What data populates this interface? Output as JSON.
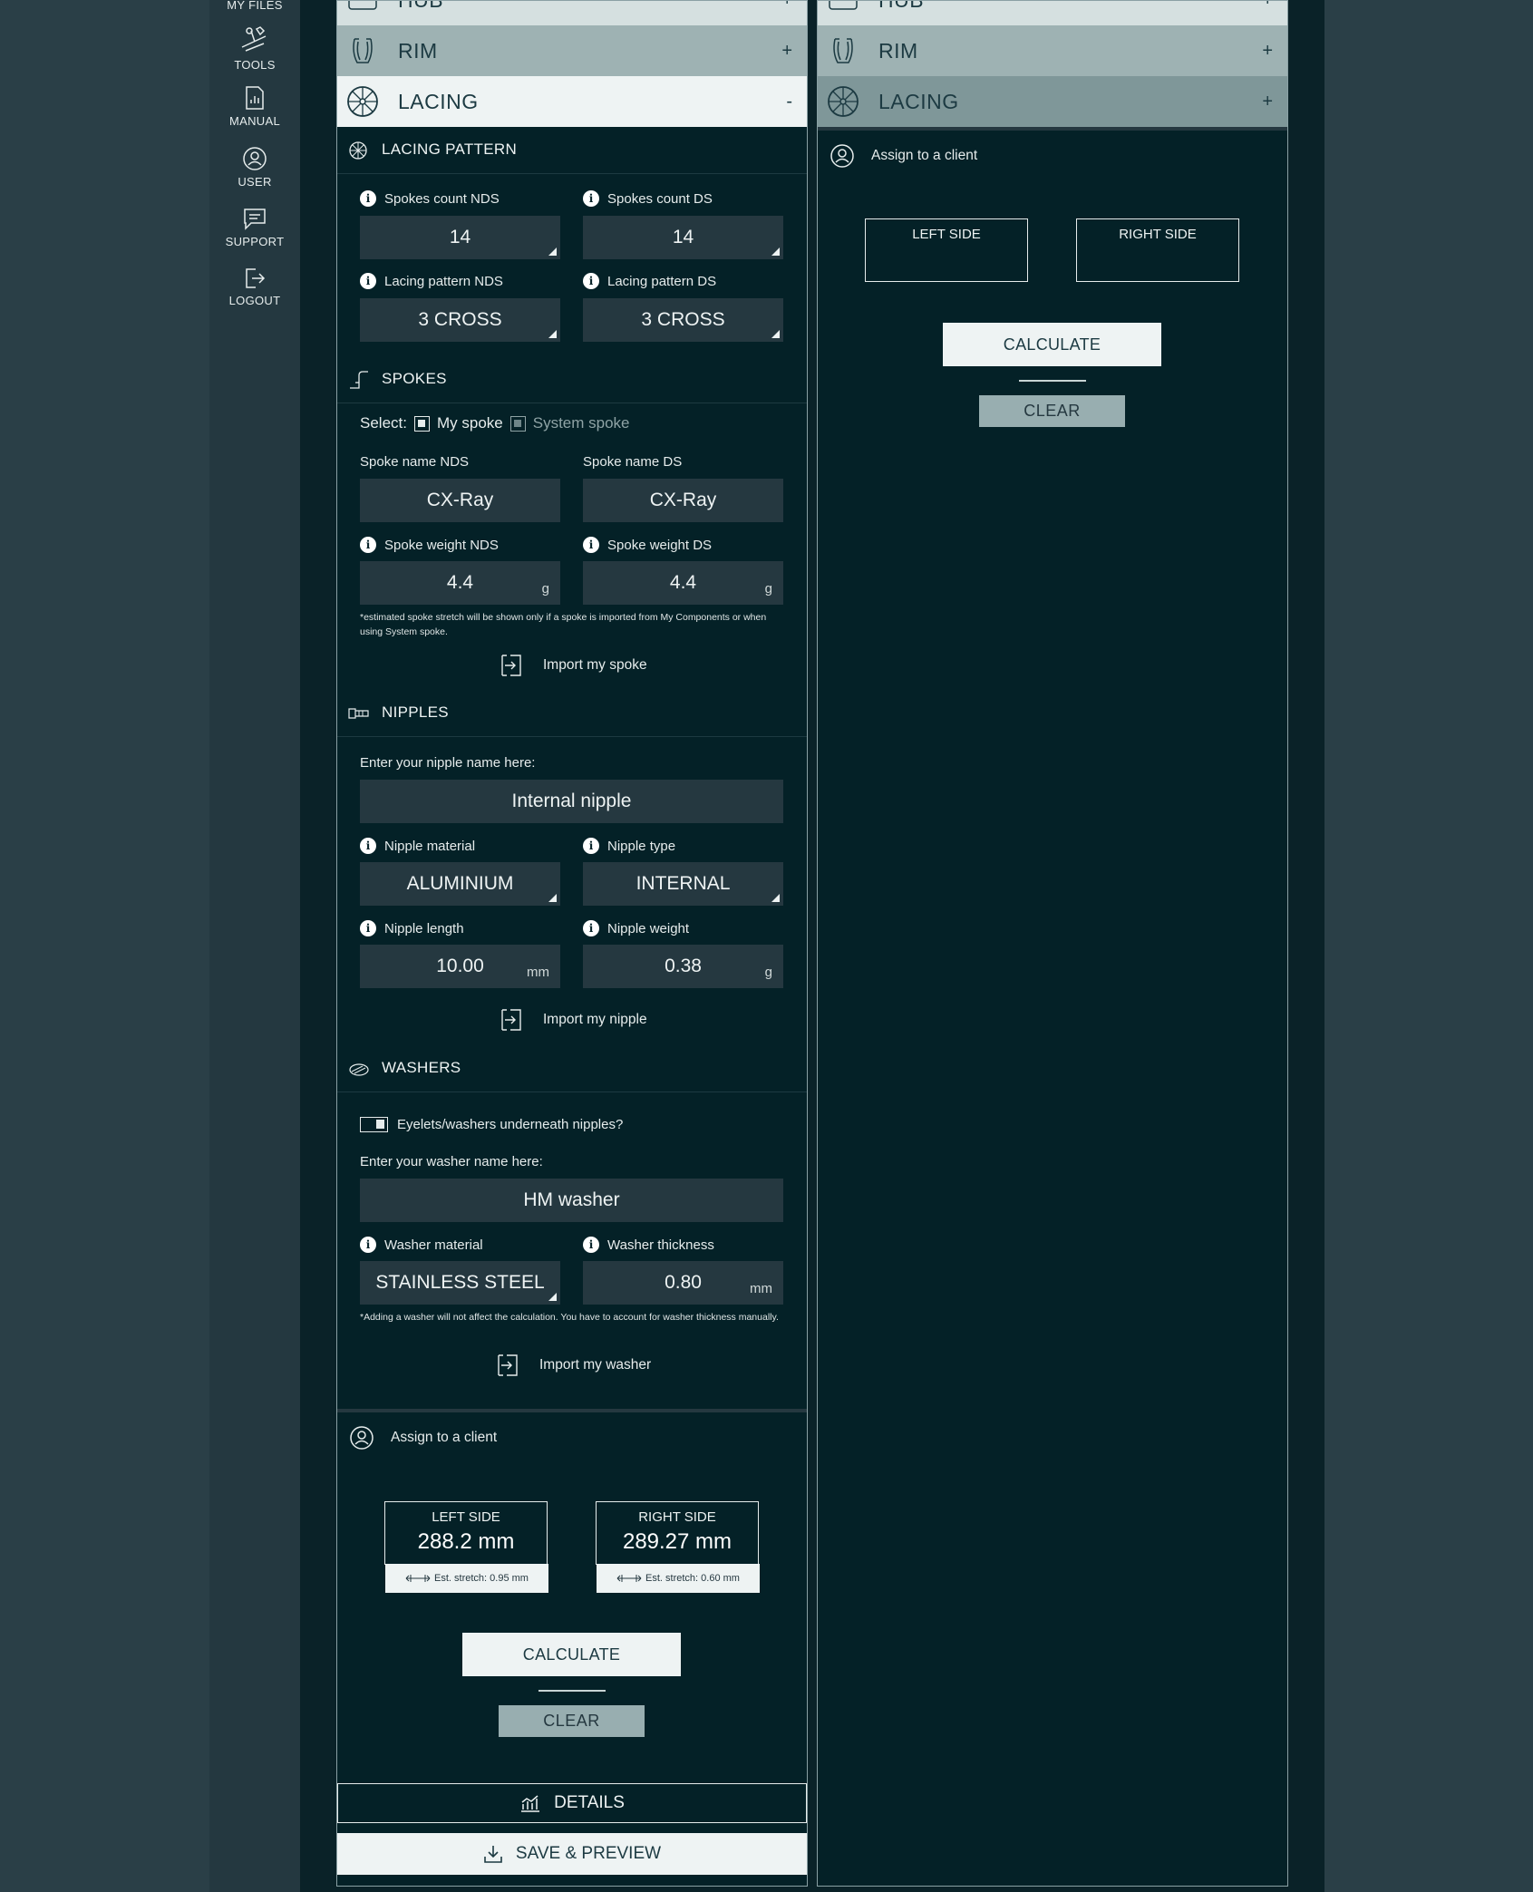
{
  "sidebar": {
    "items": [
      {
        "label": "MY FILES",
        "icon": "folder-icon"
      },
      {
        "label": "TOOLS",
        "icon": "tools-icon"
      },
      {
        "label": "MANUAL",
        "icon": "manual-icon"
      },
      {
        "label": "USER",
        "icon": "user-icon"
      },
      {
        "label": "SUPPORT",
        "icon": "support-icon"
      },
      {
        "label": "LOGOUT",
        "icon": "logout-icon"
      }
    ]
  },
  "left": {
    "accordion": {
      "hub": {
        "label": "HUB",
        "sign": "+"
      },
      "rim": {
        "label": "RIM",
        "sign": "+"
      },
      "lacing": {
        "label": "LACING",
        "sign": "-"
      }
    },
    "lacing_pattern": {
      "heading": "LACING PATTERN",
      "spokes_count_nds_label": "Spokes count NDS",
      "spokes_count_nds_value": "14",
      "spokes_count_ds_label": "Spokes count DS",
      "spokes_count_ds_value": "14",
      "pattern_nds_label": "Lacing pattern NDS",
      "pattern_nds_value": "3 CROSS",
      "pattern_ds_label": "Lacing pattern DS",
      "pattern_ds_value": "3 CROSS"
    },
    "spokes": {
      "heading": "SPOKES",
      "select_label": "Select:",
      "option_my": "My spoke",
      "option_system": "System spoke",
      "name_nds_label": "Spoke name NDS",
      "name_nds_value": "CX-Ray",
      "name_ds_label": "Spoke name DS",
      "name_ds_value": "CX-Ray",
      "weight_nds_label": "Spoke weight NDS",
      "weight_nds_value": "4.4",
      "weight_ds_label": "Spoke weight DS",
      "weight_ds_value": "4.4",
      "weight_unit": "g",
      "note": "*estimated spoke stretch will be shown only if a spoke is imported from My Components or when using System spoke.",
      "import_label": "Import my spoke"
    },
    "nipples": {
      "heading": "NIPPLES",
      "name_prompt": "Enter your nipple name here:",
      "name_value": "Internal nipple",
      "material_label": "Nipple material",
      "material_value": "ALUMINIUM",
      "type_label": "Nipple type",
      "type_value": "INTERNAL",
      "length_label": "Nipple length",
      "length_value": "10.00",
      "length_unit": "mm",
      "weight_label": "Nipple weight",
      "weight_value": "0.38",
      "weight_unit": "g",
      "import_label": "Import my nipple"
    },
    "washers": {
      "heading": "WASHERS",
      "toggle_label": "Eyelets/washers underneath nipples?",
      "name_prompt": "Enter your washer name here:",
      "name_value": "HM washer",
      "material_label": "Washer material",
      "material_value": "STAINLESS STEEL",
      "thickness_label": "Washer thickness",
      "thickness_value": "0.80",
      "thickness_unit": "mm",
      "note": "*Adding a washer will not affect the calculation. You have to account for washer thickness manually.",
      "import_label": "Import my washer"
    },
    "assign_label": "Assign to a client",
    "results": {
      "left_title": "LEFT SIDE",
      "left_value": "288.2 mm",
      "left_stretch": "Est. stretch: 0.95 mm",
      "right_title": "RIGHT SIDE",
      "right_value": "289.27 mm",
      "right_stretch": "Est. stretch: 0.60 mm"
    },
    "calculate_label": "CALCULATE",
    "clear_label": "CLEAR",
    "details_label": "DETAILS",
    "save_label": "SAVE & PREVIEW"
  },
  "right": {
    "accordion": {
      "hub": {
        "label": "HUB",
        "sign": "+"
      },
      "rim": {
        "label": "RIM",
        "sign": "+"
      },
      "lacing": {
        "label": "LACING",
        "sign": "+"
      }
    },
    "assign_label": "Assign to a client",
    "results": {
      "left_title": "LEFT SIDE",
      "right_title": "RIGHT SIDE"
    },
    "calculate_label": "CALCULATE",
    "clear_label": "CLEAR"
  }
}
